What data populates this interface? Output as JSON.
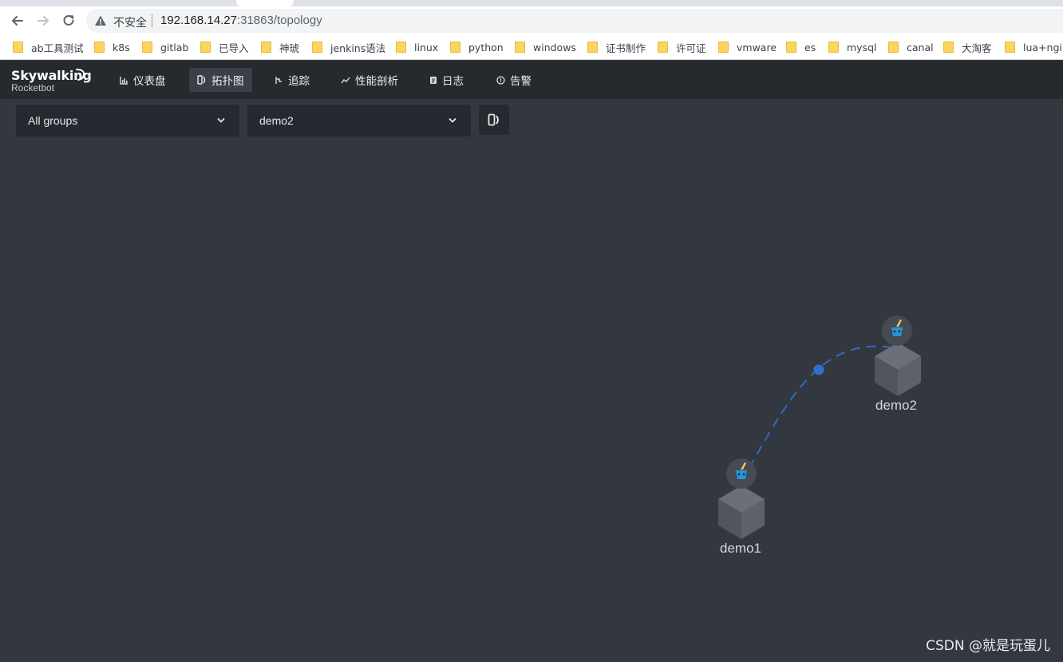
{
  "browser": {
    "security_label": "不安全",
    "url_host": "192.168.14.27",
    "url_rest": ":31863/topology"
  },
  "bookmarks": [
    "ab工具测试",
    "k8s",
    "gitlab",
    "已导入",
    "神琥",
    "jenkins语法",
    "linux",
    "python",
    "windows",
    "证书制作",
    "许可证",
    "vmware",
    "es",
    "mysql",
    "canal",
    "大淘客",
    "lua+ngin"
  ],
  "app": {
    "brand": "Skywalking",
    "subtitle": "Rocketbot",
    "nav": [
      {
        "label": "仪表盘",
        "icon": "dashboard-icon"
      },
      {
        "label": "拓扑图",
        "icon": "topology-icon",
        "active": true
      },
      {
        "label": "追踪",
        "icon": "trace-icon"
      },
      {
        "label": "性能剖析",
        "icon": "profile-icon"
      },
      {
        "label": "日志",
        "icon": "log-icon"
      },
      {
        "label": "告警",
        "icon": "alarm-icon"
      }
    ]
  },
  "filters": {
    "group": "All groups",
    "service": "demo2"
  },
  "topology": {
    "nodes": [
      {
        "name": "demo2"
      },
      {
        "name": "demo1"
      }
    ],
    "link_color": "#2f6fd1"
  },
  "watermark": "CSDN @就是玩蛋儿"
}
